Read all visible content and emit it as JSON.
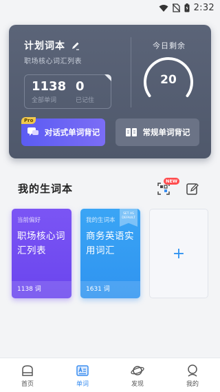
{
  "status_bar": {
    "time": "2:32"
  },
  "plan_card": {
    "title": "计划词本",
    "subtitle": "职场核心词汇列表",
    "stats": [
      {
        "value": "1138",
        "label": "全部单词"
      },
      {
        "value": "0",
        "label": "已记住"
      }
    ],
    "remaining_label": "今日剩余",
    "remaining_value": "20",
    "buttons": {
      "dialogue": "对话式单词背记",
      "dialogue_badge": "Pro",
      "regular": "常规单词背记"
    }
  },
  "vocab_section": {
    "title": "我的生词本",
    "new_badge": "NEW",
    "cards": [
      {
        "tag": "当前偏好",
        "name": "职场核心词汇列表",
        "count": "1138 词"
      },
      {
        "tag": "我的生词本",
        "name": "商务英语实用词汇",
        "count": "1631 词",
        "ribbon": "SET AS DEFAULT"
      }
    ],
    "add_symbol": "+"
  },
  "bottom_nav": {
    "items": [
      {
        "label": "首页",
        "icon": "home-icon",
        "active": false
      },
      {
        "label": "单词",
        "icon": "word-icon",
        "active": true
      },
      {
        "label": "发现",
        "icon": "planet-icon",
        "active": false
      },
      {
        "label": "我的",
        "icon": "profile-icon",
        "active": false
      }
    ]
  },
  "colors": {
    "accent": "#3a8ef0",
    "card_bg": "#555e72",
    "purple": "#6a45ee",
    "blue": "#2f93f0",
    "new_badge": "#ff4d4f",
    "pro_badge": "#f2c94c"
  }
}
